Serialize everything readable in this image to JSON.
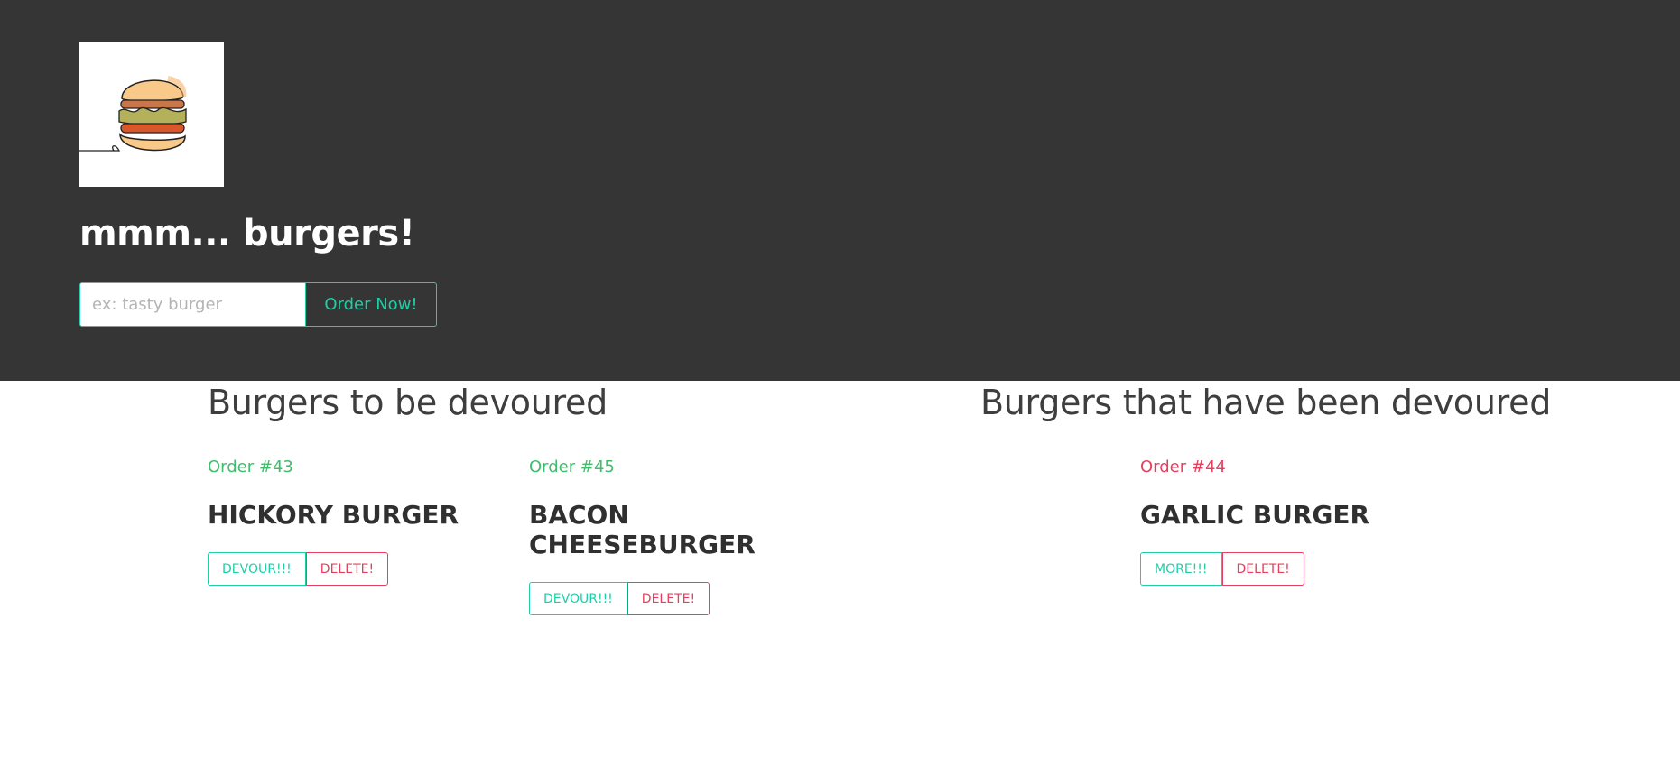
{
  "header": {
    "logo_name": "burger-logo",
    "title": "mmm... burgers!",
    "form": {
      "placeholder": "ex: tasty burger",
      "value": "",
      "submit_label": "Order Now!"
    }
  },
  "columns": {
    "undevoured": {
      "heading": "Burgers to be devoured",
      "burgers": [
        {
          "order": "Order #43",
          "name": "HICKORY BURGER",
          "primary_label": "DEVOUR!!!",
          "delete_label": "DELETE!"
        },
        {
          "order": "Order #45",
          "name": "BACON CHEESEBURGER",
          "primary_label": "DEVOUR!!!",
          "delete_label": "DELETE!"
        }
      ]
    },
    "devoured": {
      "heading": "Burgers that have been devoured",
      "burgers": [
        {
          "order": "Order #44",
          "name": "GARLIC BURGER",
          "primary_label": "MORE!!!",
          "delete_label": "DELETE!"
        }
      ]
    }
  },
  "colors": {
    "header_bg": "#353535",
    "accent_teal": "#1ecfa6",
    "accent_red": "#e6405f",
    "order_green": "#3fbd6c"
  }
}
